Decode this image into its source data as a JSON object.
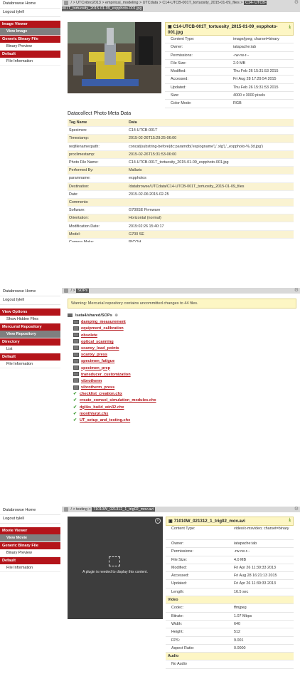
{
  "panel1": {
    "sidebar": {
      "home": "Databrowse Home",
      "logout": "Logout tylell",
      "sections": [
        {
          "head": "Image Viewer",
          "items": [
            {
              "label": "View Image",
              "active": true
            }
          ]
        },
        {
          "head": "Generic Binary File",
          "items": [
            {
              "label": "Binary Preview",
              "active": false
            }
          ]
        },
        {
          "head": "Default",
          "items": [
            {
              "label": "File Information",
              "active": false
            }
          ]
        }
      ]
    },
    "breadcrumb": {
      "path": "/ > UTCvibro2013 > empirical_modeling > UTCdata > C14-UTCB-001T_tortuosity_2015-01-09_files >",
      "current_a": "C14-",
      "current_b": "UTCB-001T_tortuosity_2015-01-09_expphoto-001.jpg"
    },
    "file_title": "C14-UTCB-001T_tortuosity_2015-01-09_expphoto-001.jpg",
    "file_info": [
      {
        "k": "Content Type:",
        "v": "image/jpeg; charset=binary"
      },
      {
        "k": "Owner:",
        "v": "iatapache:iab"
      },
      {
        "k": "Permissions:",
        "v": "-rw-rw-r--"
      },
      {
        "k": "File Size:",
        "v": "2.0 MB"
      },
      {
        "k": "Modified:",
        "v": "Thu Feb 26 15:31:53 2015"
      },
      {
        "k": "Accessed:",
        "v": "Fri Aug 28 17:29:54 2015"
      },
      {
        "k": "Updated:",
        "v": "Thu Feb 26 15:31:53 2015"
      },
      {
        "k": "Size:",
        "v": "4000 x 3000 pixels"
      },
      {
        "k": "Color Mode:",
        "v": "RGB"
      }
    ],
    "meta_heading": "Datacollect Photo Meta Data",
    "meta_header": [
      "Tag Name",
      "Data"
    ],
    "meta_rows": [
      [
        "Specimen:",
        "C14-UTCB-001T"
      ],
      [
        "Timestamp:",
        "2015-02-26T15:29:25-06:00"
      ],
      [
        "reqfilenamexpath:",
        "concat(substring-before(dc:paramdb('expiogname'),'.xlg'),'_expphoto-%.3d.jpg')"
      ],
      [
        "proclimestamp:",
        "2015-02-26T15:31:53-06:00"
      ],
      [
        "Photo File Name:",
        "C14-UTCB-001T_tortuosity_2015-01-09_expphoto-001.jpg"
      ],
      [
        "Performed By:",
        "Mallaris"
      ],
      [
        "paramname:",
        "expphotos"
      ],
      [
        "Destination:",
        "/databrowse/UTCdata/C14-UTCB-001T_tortuosity_2015-01-09_files"
      ],
      [
        "Date:",
        "2015-02-06:2015-02-25"
      ],
      [
        "Comments:",
        ""
      ],
      [
        "Software:",
        "G700SE Firmware"
      ],
      [
        "Orientation:",
        "Horizontal (normal)"
      ],
      [
        "Modification Date:",
        "2015:02:26 15:40:17"
      ],
      [
        "Model:",
        "G700 SE"
      ],
      [
        "Camera Make:",
        "RICOH"
      ]
    ]
  },
  "panel2": {
    "sidebar": {
      "home": "Databrowse Home",
      "logout": "Logout tylell",
      "sections": [
        {
          "head": "View Options",
          "items": [
            {
              "label": "Show Hidden Files",
              "active": false
            }
          ]
        },
        {
          "head": "Mercurial Repository",
          "items": [
            {
              "label": "View Repository",
              "active": true
            }
          ]
        },
        {
          "head": "Directory",
          "items": [
            {
              "label": "List",
              "active": false
            }
          ]
        },
        {
          "head": "Default",
          "items": [
            {
              "label": "File Information",
              "active": false
            }
          ]
        }
      ]
    },
    "breadcrumb": {
      "path": "/ >",
      "current": "SOPs"
    },
    "warning": "Warning: Mercurial repository contains uncommitted changes to 44 files.",
    "dir_path": "/sata4/shared/SOPs",
    "folders": [
      "damping_measurement",
      "equipment_calibration",
      "obsolete",
      "optical_scanning",
      "scanxy_load_points",
      "scanxy_press",
      "specimen_fatigue",
      "specimen_prep",
      "transducer_customization",
      "vibrotherm",
      "vibrotherm_press"
    ],
    "files": [
      "checklist_creation.chx",
      "create_comsol_simulation_modules.chx",
      "dgliks_build_win32.chx",
      "monthlyrpt.chx",
      "UT_setup_and_testing.chx"
    ]
  },
  "panel3": {
    "sidebar": {
      "home": "Databrowse Home",
      "logout": "Logout tylell",
      "sections": [
        {
          "head": "Movie Viewer",
          "items": [
            {
              "label": "View Movie",
              "active": true
            }
          ]
        },
        {
          "head": "Generic Binary File",
          "items": [
            {
              "label": "Binary Preview",
              "active": false
            }
          ]
        },
        {
          "head": "Default",
          "items": [
            {
              "label": "File Information",
              "active": false
            }
          ]
        }
      ]
    },
    "breadcrumb": {
      "path": "/ > testing >",
      "current": "71010W_021312_1_trig02_mov.avi"
    },
    "plugin_message": "A plugin is needed to display this content.",
    "file_title": "71010W_021312_1_trig02_mov.avi",
    "file_info": [
      {
        "k": "Content Type:",
        "v": "video/x-msvideo; charset=binary"
      },
      {
        "k": "Owner:",
        "v": "iatapache:iab"
      },
      {
        "k": "Permissions:",
        "v": "-rw-rw-r--"
      },
      {
        "k": "File Size:",
        "v": "4.0 MB"
      },
      {
        "k": "Modified:",
        "v": "Fri Apr 26 11:39:33 2013"
      },
      {
        "k": "Accessed:",
        "v": "Fri Aug 28 16:21:13 2015"
      },
      {
        "k": "Updated:",
        "v": "Fri Apr 26 11:39:33 2013"
      },
      {
        "k": "Length:",
        "v": "16.5 sec"
      }
    ],
    "video_head": "Video",
    "video_info": [
      {
        "k": "Codec:",
        "v": "ffmjpeg"
      },
      {
        "k": "Bitrate:",
        "v": "1.07 Mbps"
      },
      {
        "k": "Width:",
        "v": "640"
      },
      {
        "k": "Height:",
        "v": "512"
      },
      {
        "k": "FPS:",
        "v": "9.001"
      },
      {
        "k": "Aspect Ratio:",
        "v": "0.0000"
      }
    ],
    "audio_head": "Audio",
    "audio_info": "No Audio"
  }
}
